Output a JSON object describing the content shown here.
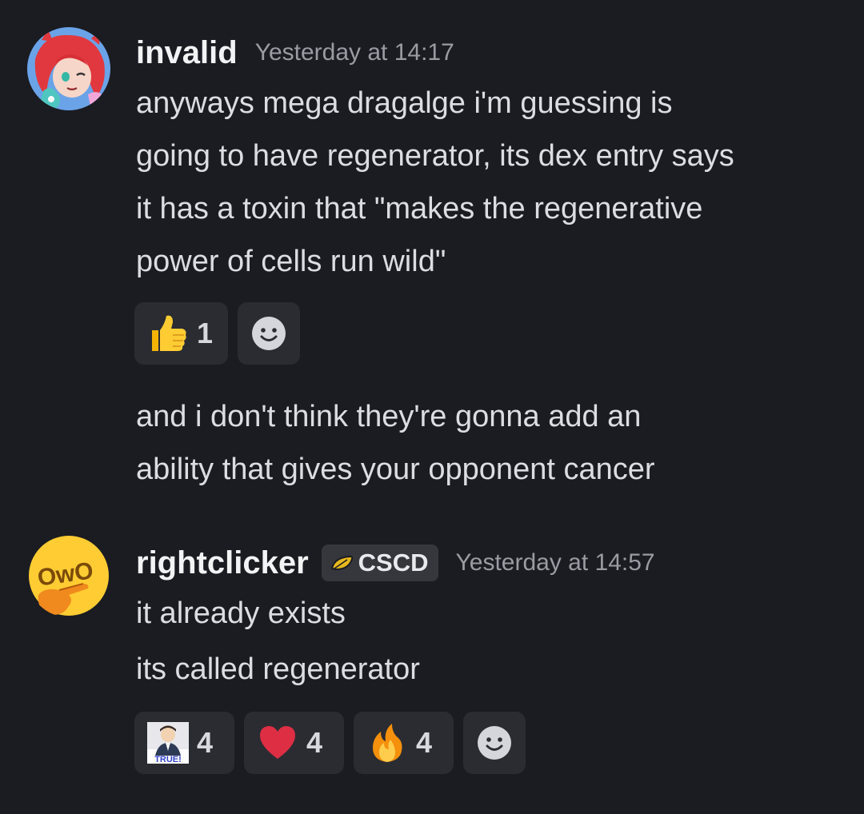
{
  "colors": {
    "background": "#1b1c21",
    "username": "#f2f3f5",
    "timestamp": "#9a9ba3",
    "message_text": "#dcdde2",
    "reaction_bg": "#2b2c32"
  },
  "messages": [
    {
      "author": "invalid",
      "timestamp": "Yesterday at 14:17",
      "avatar_icon": "anime-girl-avatar",
      "lines": [
        "anyways mega dragalge i'm guessing is",
        "going to have regenerator, its dex entry says",
        "it has a toxin that \"makes the regenerative",
        "power of cells run wild\""
      ],
      "reactions": [
        {
          "emoji": "thumbs-up-icon",
          "count": "1"
        }
      ],
      "followup_lines": [
        "and i don't think they're gonna add an",
        "ability that gives your opponent cancer"
      ]
    },
    {
      "author": "rightclicker",
      "server_tag": "CSCD",
      "server_tag_icon": "leaf-icon",
      "timestamp": "Yesterday at 14:57",
      "avatar_icon": "owo-emoji-avatar",
      "lines": [
        "it already exists",
        "its called regenerator"
      ],
      "reactions": [
        {
          "emoji": "true-custom-emoji",
          "emoji_text": "TRUE!",
          "count": "4"
        },
        {
          "emoji": "red-heart-icon",
          "count": "4"
        },
        {
          "emoji": "fire-icon",
          "count": "4"
        }
      ]
    }
  ]
}
